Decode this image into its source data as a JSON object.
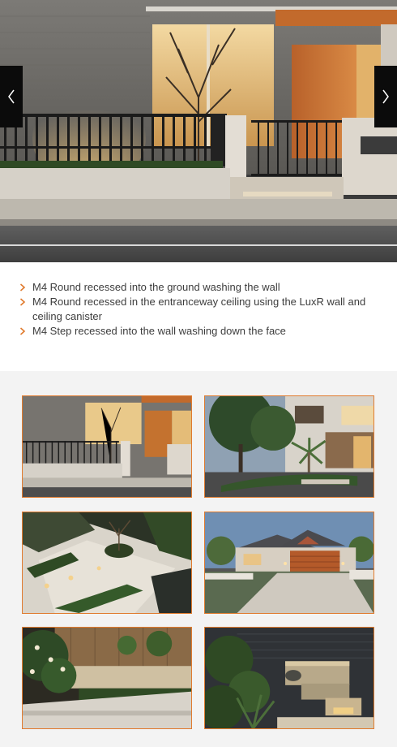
{
  "hero": {
    "prev_label": "Previous slide",
    "next_label": "Next slide"
  },
  "features": {
    "items": [
      "M4 Round recessed into the ground washing the wall",
      "M4 Round recessed in the entranceway ceiling using the LuxR wall and ceiling canister",
      "M4 Step recessed into the wall washing down the face"
    ]
  },
  "gallery": {
    "items": [
      {
        "name": "thumb-modern-facade",
        "icon": "photo"
      },
      {
        "name": "thumb-palm-garden-house",
        "icon": "photo"
      },
      {
        "name": "thumb-angled-courtyard",
        "icon": "photo"
      },
      {
        "name": "thumb-single-storey-home",
        "icon": "photo"
      },
      {
        "name": "thumb-frangipani-garden",
        "icon": "photo"
      },
      {
        "name": "thumb-stone-water-feature",
        "icon": "photo"
      }
    ]
  },
  "colors": {
    "accent": "#e07b2f",
    "text": "#3d3d3d",
    "gallery_bg": "#f3f3f3"
  }
}
